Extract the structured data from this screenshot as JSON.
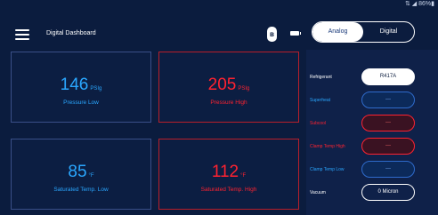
{
  "status_bar": {
    "text": "⇅ ◢ 86%▮"
  },
  "header": {
    "title": "Digital Dashboard",
    "bluetooth_glyph": "ʙ",
    "mode_toggle": {
      "options": [
        "Analog",
        "Digital"
      ],
      "selected": "Analog"
    }
  },
  "cards": [
    {
      "value": "146",
      "unit": "PSIg",
      "label": "Pressure Low",
      "state": "low"
    },
    {
      "value": "205",
      "unit": "PSIg",
      "label": "Pressure High",
      "state": "high"
    },
    {
      "value": "85",
      "unit": "°F",
      "label": "Saturated Temp. Low",
      "state": "low"
    },
    {
      "value": "112",
      "unit": "°F",
      "label": "Saturated Temp. High",
      "state": "high"
    }
  ],
  "side_panel": {
    "rows": [
      {
        "label": "Refrigerant",
        "value": "R417A"
      },
      {
        "label": "Superheat",
        "value": "---"
      },
      {
        "label": "Subcool",
        "value": "---"
      },
      {
        "label": "Clamp Temp High",
        "value": "---"
      },
      {
        "label": "Clamp Temp Low",
        "value": "---"
      },
      {
        "label": "Vacuum",
        "value": "0 Micron"
      }
    ]
  },
  "colors": {
    "background": "#0b1c3e",
    "low_accent": "#2aa7ff",
    "high_accent": "#ff2230"
  }
}
